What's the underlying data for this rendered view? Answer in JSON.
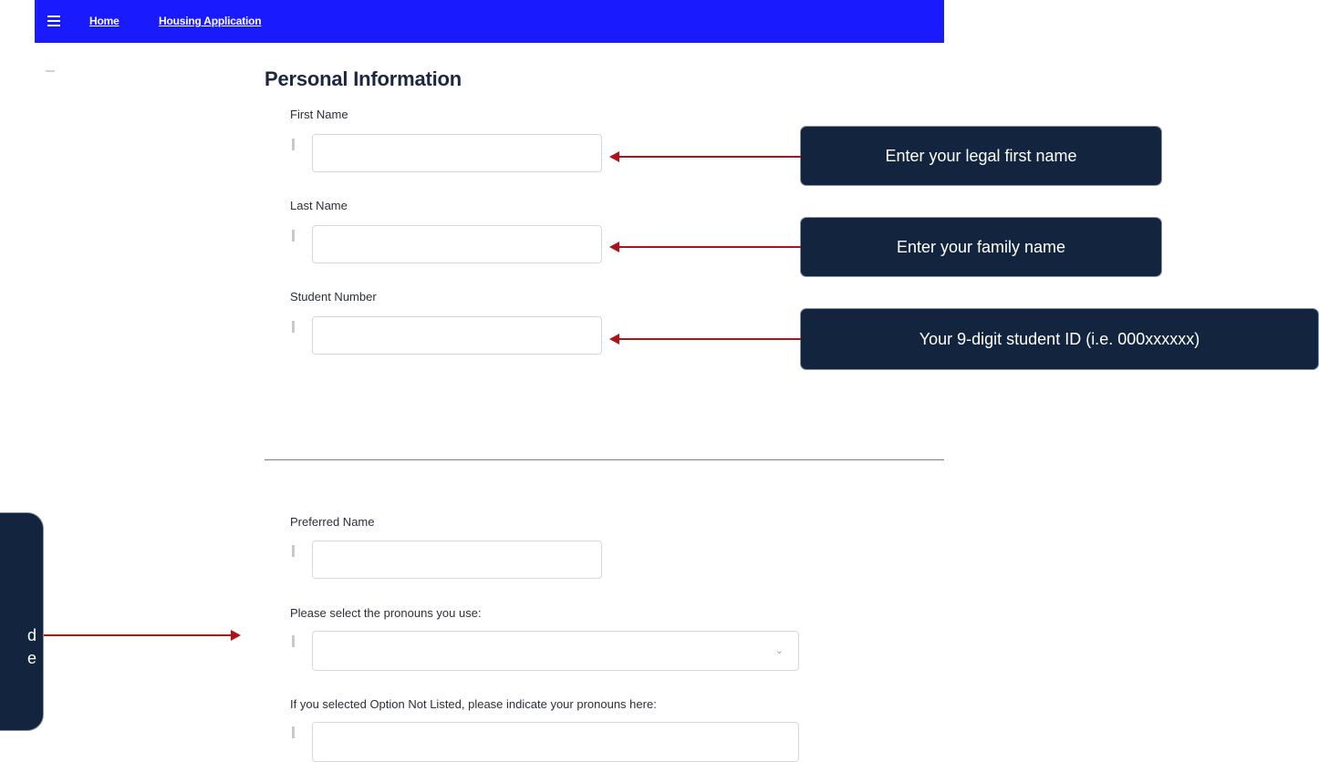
{
  "nav": {
    "home_label": "Home",
    "app_label": "Housing Application"
  },
  "form": {
    "heading": "Personal Information",
    "first_name_label": "First Name",
    "last_name_label": "Last Name",
    "student_number_label": "Student Number",
    "preferred_name_label": "Preferred Name",
    "pronouns_label": "Please select the pronouns you use:",
    "other_pronouns_label": "If you selected Option Not Listed, please indicate your pronouns here:"
  },
  "callouts": {
    "first_name": "Enter your legal first name",
    "last_name": "Enter your family name",
    "student_number": "Your 9-digit student ID (i.e. 000xxxxxx)",
    "left_line1": "d",
    "left_line2": "e"
  },
  "icons": {
    "menu": "hamburger-menu-icon",
    "chevron": "chevron-down-icon"
  },
  "colors": {
    "nav_bar": "#1a1aff",
    "callout_bg": "#13243f",
    "arrow": "#b01217"
  }
}
